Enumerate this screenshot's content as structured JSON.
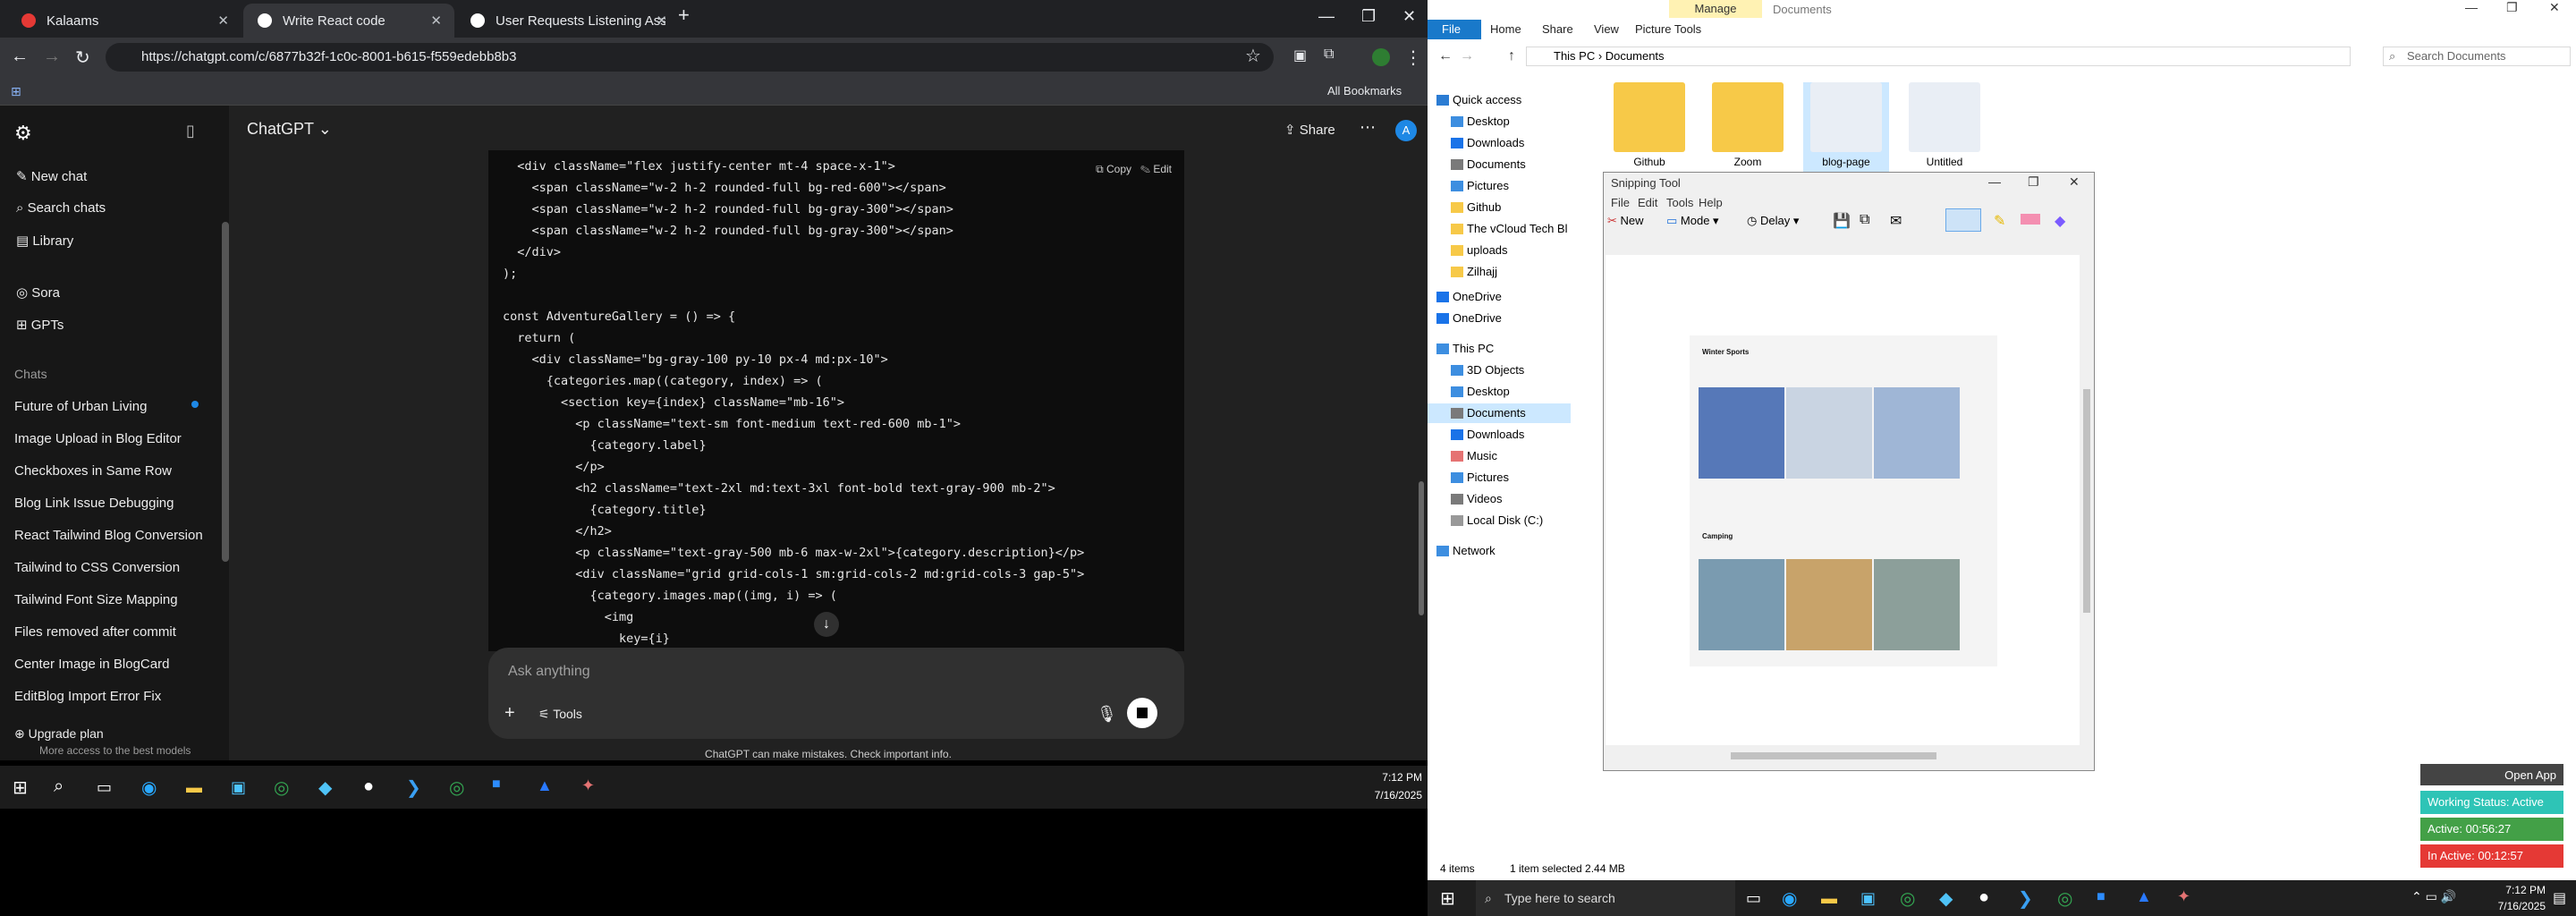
{
  "chrome": {
    "tabs": [
      {
        "label": "Kalaams"
      },
      {
        "label": "Write React code"
      },
      {
        "label": "User Requests Listening Assista"
      }
    ],
    "url": "https://chatgpt.com/c/6877b32f-1c0c-8001-b615-f559edebb8b3",
    "all_bookmarks": "All Bookmarks",
    "new_tab": "+"
  },
  "chatgpt": {
    "title": "ChatGPT",
    "share": "Share",
    "avatar": "A",
    "nav": [
      {
        "label": "New chat"
      },
      {
        "label": "Search chats"
      },
      {
        "label": "Library"
      },
      {
        "label": "Sora"
      },
      {
        "label": "GPTs"
      }
    ],
    "chats_label": "Chats",
    "chats": [
      "Future of Urban Living",
      "Image Upload in Blog Editor",
      "Checkboxes in Same Row",
      "Blog Link Issue Debugging",
      "React Tailwind Blog Conversion",
      "Tailwind to CSS Conversion",
      "Tailwind Font Size Mapping",
      "Files removed after commit",
      "Center Image in BlogCard",
      "EditBlog Import Error Fix"
    ],
    "upgrade": "Upgrade plan",
    "upgrade_sub": "More access to the best models",
    "copy": "Copy",
    "edit": "Edit",
    "composer_placeholder": "Ask anything",
    "tools": "Tools",
    "disclaimer": "ChatGPT can make mistakes. Check important info.",
    "code_lines": [
      "  <div className=\"flex justify-center mt-4 space-x-1\">",
      "    <span className=\"w-2 h-2 rounded-full bg-red-600\"></span>",
      "    <span className=\"w-2 h-2 rounded-full bg-gray-300\"></span>",
      "    <span className=\"w-2 h-2 rounded-full bg-gray-300\"></span>",
      "  </div>",
      ");",
      "",
      "const AdventureGallery = () => {",
      "  return (",
      "    <div className=\"bg-gray-100 py-10 px-4 md:px-10\">",
      "      {categories.map((category, index) => (",
      "        <section key={index} className=\"mb-16\">",
      "          <p className=\"text-sm font-medium text-red-600 mb-1\">",
      "            {category.label}",
      "          </p>",
      "          <h2 className=\"text-2xl md:text-3xl font-bold text-gray-900 mb-2\">",
      "            {category.title}",
      "          </h2>",
      "          <p className=\"text-gray-500 mb-6 max-w-2xl\">{category.description}</p>",
      "          <div className=\"grid grid-cols-1 sm:grid-cols-2 md:grid-cols-3 gap-5\">",
      "            {category.images.map((img, i) => (",
      "              <img",
      "                key={i}"
    ]
  },
  "taskbar_left": {
    "time": "7:12 PM",
    "date": "7/16/2025"
  },
  "explorer": {
    "ribbon_tabs": [
      "File",
      "Home",
      "Share",
      "View",
      "Picture Tools"
    ],
    "manage": "Manage",
    "documents_title": "Documents",
    "breadcrumb": [
      "This PC",
      "Documents"
    ],
    "search_placeholder": "Search Documents",
    "nav": [
      "Quick access",
      "Desktop",
      "Downloads",
      "Documents",
      "Pictures",
      "Github",
      "The vCloud Tech Bl",
      "uploads",
      "Zilhajj",
      "OneDrive",
      "OneDrive",
      "This PC",
      "3D Objects",
      "Desktop",
      "Documents",
      "Downloads",
      "Music",
      "Pictures",
      "Videos",
      "Local Disk (C:)",
      "Network"
    ],
    "folders": [
      "Github",
      "Zoom",
      "blog-page",
      "Untitled"
    ],
    "status_items": "4 items",
    "status_selected": "1 item selected  2.44 MB"
  },
  "snipping": {
    "title": "Snipping Tool",
    "menu": [
      "File",
      "Edit",
      "Tools",
      "Help"
    ],
    "new": "New",
    "mode": "Mode",
    "delay": "Delay",
    "winter": "Winter Sports",
    "camping": "Camping"
  },
  "taskbar_right": {
    "search": "Type here to search",
    "time": "7:12 PM",
    "date": "7/16/2025"
  },
  "timer": {
    "open_app": "Open App",
    "status": "Working Status: Active",
    "active": "Active: 00:56:27",
    "inactive": "In Active: 00:12:57"
  }
}
